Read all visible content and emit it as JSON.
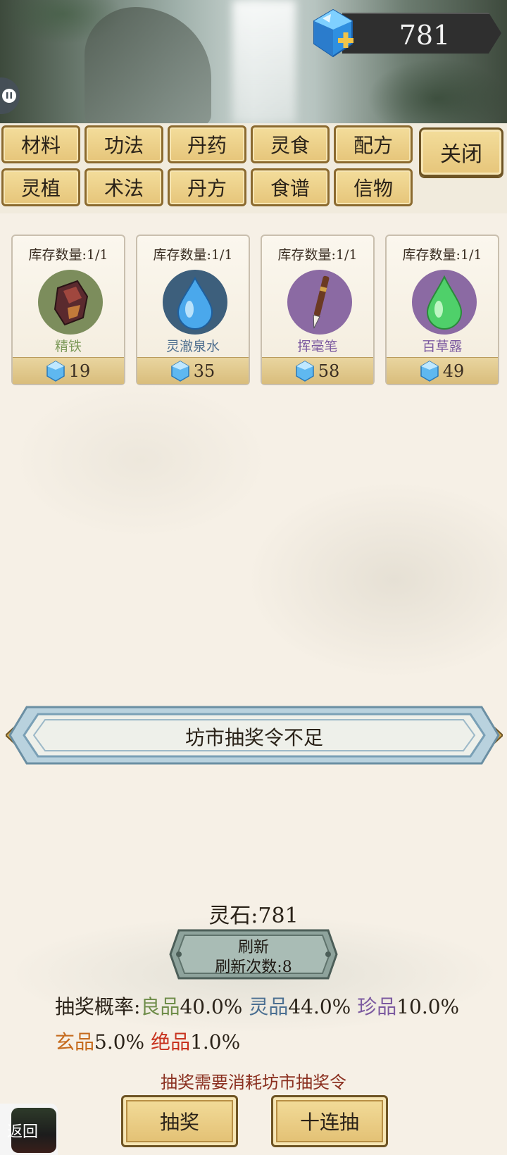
{
  "header": {
    "currency_value": "781",
    "currency_icon": "spirit-stone-gem-icon",
    "chat_icon": "chat-bubble-icon"
  },
  "tabs": {
    "row1": [
      "材料",
      "功法",
      "丹药",
      "灵食",
      "配方"
    ],
    "row2": [
      "灵植",
      "术法",
      "丹方",
      "食谱",
      "信物"
    ],
    "close_label": "关闭"
  },
  "items": [
    {
      "stock": "库存数量:1/1",
      "name": "精铁",
      "price": "19",
      "name_color": "#7d9a5a",
      "icon": "iron-ore-icon",
      "icon_bg": "#7c8d5c"
    },
    {
      "stock": "库存数量:1/1",
      "name": "灵澈泉水",
      "price": "35",
      "name_color": "#4f6f8f",
      "icon": "water-drop-icon",
      "icon_bg": "#3d5f7c"
    },
    {
      "stock": "库存数量:1/1",
      "name": "挥毫笔",
      "price": "58",
      "name_color": "#7c5aa0",
      "icon": "brush-pen-icon",
      "icon_bg": "#8b6aa3"
    },
    {
      "stock": "库存数量:1/1",
      "name": "百草露",
      "price": "49",
      "name_color": "#7c5aa0",
      "icon": "green-drop-icon",
      "icon_bg": "#8b6aa3"
    }
  ],
  "notice": {
    "text": "坊市抽奖令不足"
  },
  "footer": {
    "lingshi_label": "灵石:781",
    "refresh_label": "刷新",
    "refresh_count": "刷新次数:8",
    "prob_label": "抽奖概率:",
    "probabilities": [
      {
        "name": "良品",
        "value": "40.0%",
        "color": "#6f8d4a"
      },
      {
        "name": "灵品",
        "value": "44.0%",
        "color": "#4b6f91"
      },
      {
        "name": "珍品",
        "value": "10.0%",
        "color": "#7c5aa0"
      },
      {
        "name": "玄品",
        "value": "5.0%",
        "color": "#c56a1c"
      },
      {
        "name": "绝品",
        "value": "1.0%",
        "color": "#c8321e"
      }
    ],
    "hint": "抽奖需要消耗坊市抽奖令",
    "draw_label": "抽奖",
    "draw_ten_label": "十连抽",
    "back_label": "返回"
  }
}
